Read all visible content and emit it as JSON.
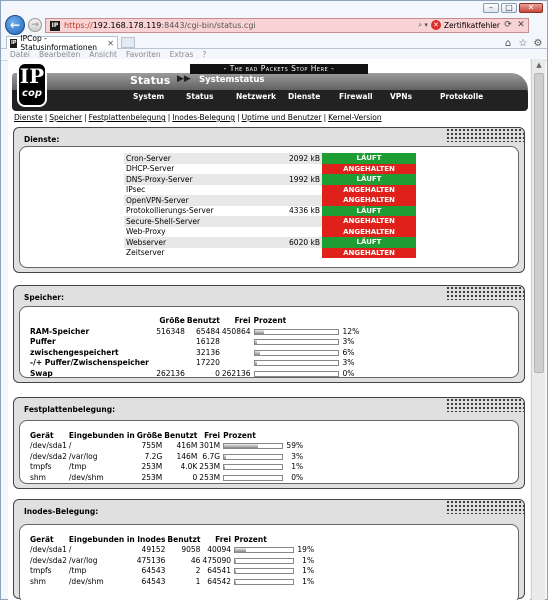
{
  "browser": {
    "url_scheme": "https://",
    "url_host": "192.168.178.119",
    "url_rest": ":8443/cgi-bin/status.cgi",
    "cert_error": "Zertifikatfehler",
    "tab_title": "IPCop - Statusinformationen",
    "menu": [
      "Datei",
      "Bearbeiten",
      "Ansicht",
      "Favoriten",
      "Extras",
      "?"
    ]
  },
  "header": {
    "slogan": "- The bad Packets Stop Here -",
    "logo_top": "IP",
    "logo_bottom": "cop",
    "title": "Status",
    "arrows": "▶▶",
    "subtitle": "Systemstatus",
    "nav": [
      "System",
      "Status",
      "Netzwerk",
      "Dienste",
      "Firewall",
      "VPNs",
      "Protokolle"
    ]
  },
  "subnav": [
    "Dienste",
    "Speicher",
    "Festplattenbelegung",
    "Inodes-Belegung",
    "Uptime und Benutzer",
    "Kernel-Version"
  ],
  "services": {
    "title": "Dienste:",
    "rows": [
      {
        "name": "Cron-Server",
        "mem": "2092 kB",
        "status": "LÄUFT",
        "ok": true
      },
      {
        "name": "DHCP-Server",
        "mem": "",
        "status": "ANGEHALTEN",
        "ok": false
      },
      {
        "name": "DNS-Proxy-Server",
        "mem": "1992 kB",
        "status": "LÄUFT",
        "ok": true
      },
      {
        "name": "IPsec",
        "mem": "",
        "status": "ANGEHALTEN",
        "ok": false
      },
      {
        "name": "OpenVPN-Server",
        "mem": "",
        "status": "ANGEHALTEN",
        "ok": false
      },
      {
        "name": "Protokollierungs-Server",
        "mem": "4336 kB",
        "status": "LÄUFT",
        "ok": true
      },
      {
        "name": "Secure-Shell-Server",
        "mem": "",
        "status": "ANGEHALTEN",
        "ok": false
      },
      {
        "name": "Web-Proxy",
        "mem": "",
        "status": "ANGEHALTEN",
        "ok": false
      },
      {
        "name": "Webserver",
        "mem": "6020 kB",
        "status": "LÄUFT",
        "ok": true
      },
      {
        "name": "Zeitserver",
        "mem": "",
        "status": "ANGEHALTEN",
        "ok": false
      }
    ]
  },
  "memory": {
    "title": "Speicher:",
    "headers": [
      "Größe",
      "Benutzt",
      "Frei",
      "Prozent"
    ],
    "rows": [
      {
        "label": "RAM-Speicher",
        "size": "516348",
        "used": "65484",
        "free": "450864",
        "pct": "12%",
        "fraction": 0.12
      },
      {
        "label": "Puffer",
        "size": "",
        "used": "16128",
        "free": "",
        "pct": "3%",
        "fraction": 0.03
      },
      {
        "label": "zwischengespeichert",
        "size": "",
        "used": "32136",
        "free": "",
        "pct": "6%",
        "fraction": 0.06
      },
      {
        "label": "-/+ Puffer/Zwischenspeicher",
        "size": "",
        "used": "17220",
        "free": "",
        "pct": "3%",
        "fraction": 0.03
      },
      {
        "label": "Swap",
        "size": "262136",
        "used": "0",
        "free": "262136",
        "pct": "0%",
        "fraction": 0.0
      }
    ]
  },
  "disk": {
    "title": "Festplattenbelegung:",
    "headers": [
      "Gerät",
      "Eingebunden in",
      "Größe",
      "Benutzt",
      "Frei",
      "Prozent"
    ],
    "rows": [
      {
        "dev": "/dev/sda1",
        "mount": "/",
        "size": "755M",
        "used": "416M",
        "free": "301M",
        "pct": "59%",
        "fraction": 0.59
      },
      {
        "dev": "/dev/sda2",
        "mount": "/var/log",
        "size": "7.2G",
        "used": "146M",
        "free": "6.7G",
        "pct": "3%",
        "fraction": 0.03
      },
      {
        "dev": "tmpfs",
        "mount": "/tmp",
        "size": "253M",
        "used": "4.0K",
        "free": "253M",
        "pct": "1%",
        "fraction": 0.01
      },
      {
        "dev": "shm",
        "mount": "/dev/shm",
        "size": "253M",
        "used": "0",
        "free": "253M",
        "pct": "0%",
        "fraction": 0.0
      }
    ]
  },
  "inodes": {
    "title": "Inodes-Belegung:",
    "headers": [
      "Gerät",
      "Eingebunden in",
      "Inodes",
      "Benutzt",
      "Frei",
      "Prozent"
    ],
    "rows": [
      {
        "dev": "/dev/sda1",
        "mount": "/",
        "size": "49152",
        "used": "9058",
        "free": "40094",
        "pct": "19%",
        "fraction": 0.19
      },
      {
        "dev": "/dev/sda2",
        "mount": "/var/log",
        "size": "475136",
        "used": "46",
        "free": "475090",
        "pct": "1%",
        "fraction": 0.01
      },
      {
        "dev": "tmpfs",
        "mount": "/tmp",
        "size": "64543",
        "used": "2",
        "free": "64541",
        "pct": "1%",
        "fraction": 0.01
      },
      {
        "dev": "shm",
        "mount": "/dev/shm",
        "size": "64543",
        "used": "1",
        "free": "64542",
        "pct": "1%",
        "fraction": 0.01
      }
    ]
  }
}
